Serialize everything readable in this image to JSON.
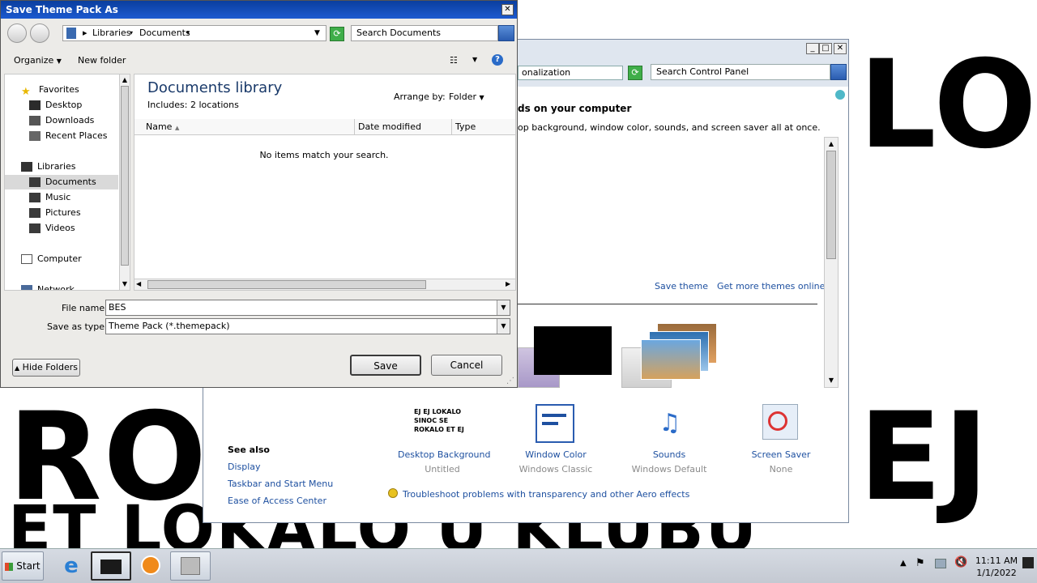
{
  "wallpaper": {
    "line1": "RO",
    "line1_right": "EJ",
    "line2": "ET LOKALO U KLUBU",
    "top_fragment": "LO"
  },
  "control_panel": {
    "breadcrumb": "onalization",
    "search_placeholder": "Search Control Panel",
    "heading": "ds on your computer",
    "subtext": "op background, window color, sounds, and screen saver all at once.",
    "save_theme": "Save theme",
    "get_more": "Get more themes online",
    "see_also_title": "See also",
    "see_also": [
      "Display",
      "Taskbar and Start Menu",
      "Ease of Access Center"
    ],
    "items": [
      {
        "label": "Desktop Background",
        "sub": "Untitled",
        "icon": "desktop-background-icon",
        "thumb_text": "EJ EJ LOKALO SINOC SE ROKALO ET EJ"
      },
      {
        "label": "Window Color",
        "sub": "Windows Classic",
        "icon": "window-color-icon"
      },
      {
        "label": "Sounds",
        "sub": "Windows Default",
        "icon": "sounds-icon"
      },
      {
        "label": "Screen Saver",
        "sub": "None",
        "icon": "screen-saver-icon"
      }
    ],
    "troubleshoot": "Troubleshoot problems with transparency and other Aero effects"
  },
  "dialog": {
    "title": "Save Theme Pack As",
    "breadcrumb": [
      "Libraries",
      "Documents"
    ],
    "search_placeholder": "Search Documents",
    "organize": "Organize",
    "new_folder": "New folder",
    "nav": {
      "favorites": "Favorites",
      "favorites_items": [
        "Desktop",
        "Downloads",
        "Recent Places"
      ],
      "libraries": "Libraries",
      "libraries_items": [
        "Documents",
        "Music",
        "Pictures",
        "Videos"
      ],
      "computer": "Computer",
      "network": "Network"
    },
    "library_title": "Documents library",
    "includes": "Includes:",
    "includes_link": "2 locations",
    "arrange_by_label": "Arrange by:",
    "arrange_by_value": "Folder",
    "columns": [
      "Name",
      "Date modified",
      "Type"
    ],
    "empty_message": "No items match your search.",
    "file_name_label": "File name:",
    "file_name_value": "BES",
    "save_type_label": "Save as type:",
    "save_type_value": "Theme Pack (*.themepack)",
    "hide_folders": "Hide Folders",
    "save": "Save",
    "cancel": "Cancel"
  },
  "taskbar": {
    "start": "Start",
    "time": "11:11 AM",
    "date": "1/1/2022"
  }
}
